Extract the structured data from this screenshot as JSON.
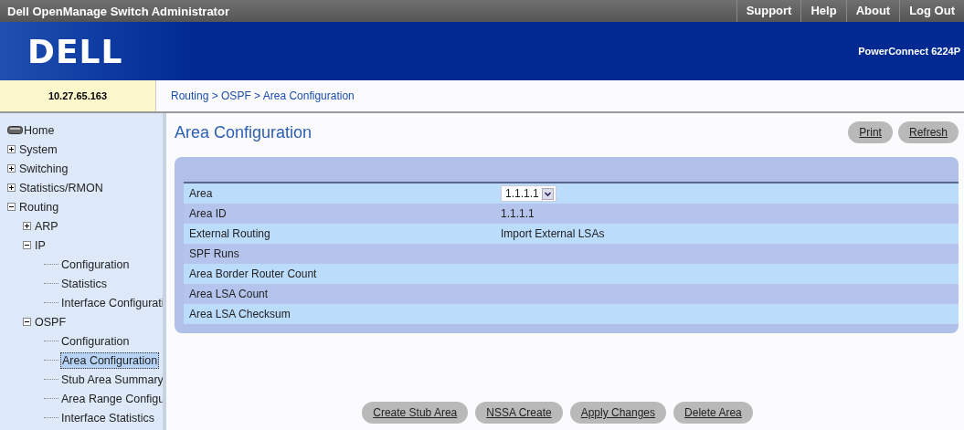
{
  "title_bar": {
    "title": "Dell OpenManage Switch Administrator",
    "links": [
      "Support",
      "Help",
      "About",
      "Log Out"
    ]
  },
  "banner": {
    "logo": "DELL",
    "model": "PowerConnect 6224P"
  },
  "address": "10.27.65.163",
  "breadcrumb": "Routing > OSPF > Area Configuration",
  "sidebar": {
    "items": [
      {
        "label": "Home",
        "kind": "home",
        "selected": false
      },
      {
        "label": "System",
        "kind": "folder",
        "expanded": false,
        "selected": false
      },
      {
        "label": "Switching",
        "kind": "folder",
        "expanded": false,
        "selected": false
      },
      {
        "label": "Statistics/RMON",
        "kind": "folder",
        "expanded": false,
        "selected": false
      },
      {
        "label": "Routing",
        "kind": "folder",
        "expanded": true,
        "selected": false,
        "children": [
          {
            "label": "ARP",
            "kind": "folder",
            "expanded": false,
            "selected": false
          },
          {
            "label": "IP",
            "kind": "folder",
            "expanded": true,
            "selected": false,
            "children": [
              {
                "label": "Configuration",
                "kind": "leaf",
                "selected": false
              },
              {
                "label": "Statistics",
                "kind": "leaf",
                "selected": false
              },
              {
                "label": "Interface Configurati",
                "kind": "leaf",
                "selected": false
              }
            ]
          },
          {
            "label": "OSPF",
            "kind": "folder",
            "expanded": true,
            "selected": false,
            "children": [
              {
                "label": "Configuration",
                "kind": "leaf",
                "selected": false
              },
              {
                "label": "Area Configuration",
                "kind": "leaf",
                "selected": true
              },
              {
                "label": "Stub Area Summary",
                "kind": "leaf",
                "selected": false
              },
              {
                "label": "Area Range Configu",
                "kind": "leaf",
                "selected": false
              },
              {
                "label": "Interface Statistics",
                "kind": "leaf",
                "selected": false
              }
            ]
          }
        ]
      }
    ]
  },
  "page": {
    "title": "Area Configuration",
    "top_buttons": [
      "Print",
      "Refresh"
    ],
    "rows": [
      {
        "label": "Area",
        "kind": "select",
        "value": "1.1.1.1"
      },
      {
        "label": "Area ID",
        "kind": "text",
        "value": "1.1.1.1"
      },
      {
        "label": "External Routing",
        "kind": "text",
        "value": "Import External LSAs"
      },
      {
        "label": "SPF Runs",
        "kind": "text"
      },
      {
        "label": "Area Border Router Count",
        "kind": "text"
      },
      {
        "label": "Area LSA Count",
        "kind": "text"
      },
      {
        "label": "Area LSA Checksum",
        "kind": "text"
      }
    ],
    "buttons": [
      "Create Stub Area",
      "NSSA Create",
      "Apply Changes",
      "Delete Area"
    ]
  }
}
